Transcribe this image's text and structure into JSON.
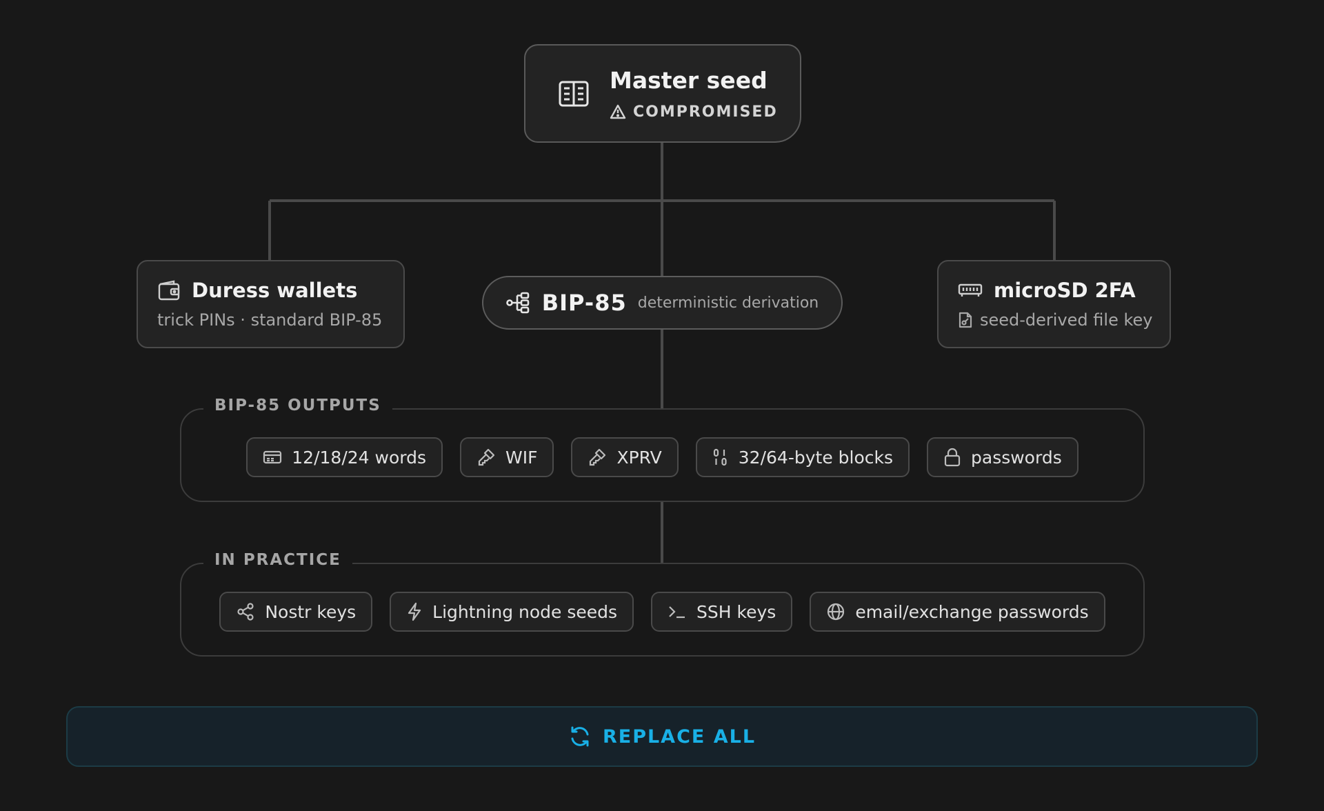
{
  "master": {
    "title": "Master seed",
    "status": "COMPROMISED",
    "icon": "book-icon"
  },
  "duress": {
    "title": "Duress wallets",
    "subtitle": "trick PINs · standard BIP-85",
    "icon": "wallet-icon"
  },
  "bip85": {
    "title": "BIP-85",
    "description": "deterministic derivation",
    "icon": "hierarchy-icon"
  },
  "microsd": {
    "title": "microSD 2FA",
    "subtitle": "seed-derived file key",
    "icon": "memory-card-icon"
  },
  "outputs": {
    "legend": "BIP-85 OUTPUTS",
    "items": [
      {
        "label": "12/18/24 words",
        "icon": "card-icon"
      },
      {
        "label": "WIF",
        "icon": "key-icon"
      },
      {
        "label": "XPRV",
        "icon": "key-icon"
      },
      {
        "label": "32/64-byte blocks",
        "icon": "binary-icon"
      },
      {
        "label": "passwords",
        "icon": "lock-icon"
      }
    ]
  },
  "practice": {
    "legend": "IN PRACTICE",
    "items": [
      {
        "label": "Nostr keys",
        "icon": "share-icon"
      },
      {
        "label": "Lightning node seeds",
        "icon": "lightning-icon"
      },
      {
        "label": "SSH keys",
        "icon": "terminal-icon"
      },
      {
        "label": "email/exchange passwords",
        "icon": "globe-icon"
      }
    ]
  },
  "action": {
    "label": "REPLACE ALL",
    "icon": "refresh-icon"
  },
  "colors": {
    "background": "#181818",
    "accent": "#19b0e6",
    "border": "#4a4a4a"
  }
}
